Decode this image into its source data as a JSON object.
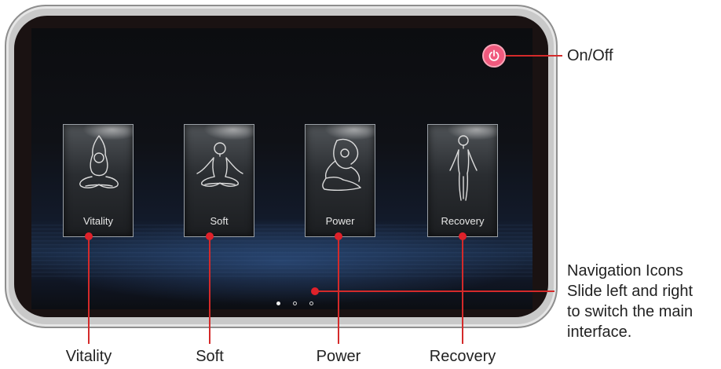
{
  "modes": [
    {
      "label": "Vitality",
      "icon": "raised-arms-yoga-icon"
    },
    {
      "label": "Soft",
      "icon": "meditation-icon"
    },
    {
      "label": "Power",
      "icon": "stretch-pose-icon"
    },
    {
      "label": "Recovery",
      "icon": "standing-figure-icon"
    }
  ],
  "callouts": {
    "power": "On/Off",
    "navigation_lines": [
      "Navigation Icons",
      "Slide left and right",
      "to switch the main",
      "interface."
    ]
  },
  "bottom_labels": [
    "Vitality",
    "Soft",
    "Power",
    "Recovery"
  ],
  "pager": {
    "pages": 3,
    "active": 1
  },
  "colors": {
    "accent": "#e0202a",
    "power_button": "#f05a7e"
  }
}
